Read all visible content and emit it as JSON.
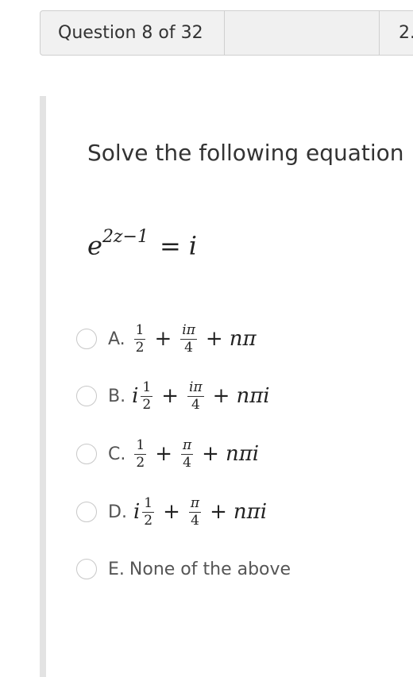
{
  "header": {
    "question_counter": "Question 8 of 32",
    "next_item_label": "2."
  },
  "question": {
    "prompt": "Solve the following equation",
    "equation": {
      "base": "e",
      "exponent": "2z−1",
      "equals": "=",
      "rhs": "i"
    }
  },
  "options": [
    {
      "letter": "A.",
      "parts": {
        "f1_num": "1",
        "f1_den": "2",
        "f2_num": "iπ",
        "f2_den": "4",
        "tail": "nπ"
      }
    },
    {
      "letter": "B.",
      "parts": {
        "prefix": "i",
        "f1_num": "1",
        "f1_den": "2",
        "f2_num": "iπ",
        "f2_den": "4",
        "tail": "nπi"
      }
    },
    {
      "letter": "C.",
      "parts": {
        "f1_num": "1",
        "f1_den": "2",
        "f2_num": "π",
        "f2_den": "4",
        "tail": "nπi"
      }
    },
    {
      "letter": "D.",
      "parts": {
        "prefix": "i",
        "f1_num": "1",
        "f1_den": "2",
        "f2_num": "π",
        "f2_den": "4",
        "tail": "nπi"
      }
    },
    {
      "letter": "E.",
      "text": "None of the above"
    }
  ],
  "colors": {
    "header_bg": "#f1f1f1",
    "border": "#cfcfcf",
    "rail": "#e3e3e3",
    "text": "#333333",
    "option_text": "#555555"
  }
}
